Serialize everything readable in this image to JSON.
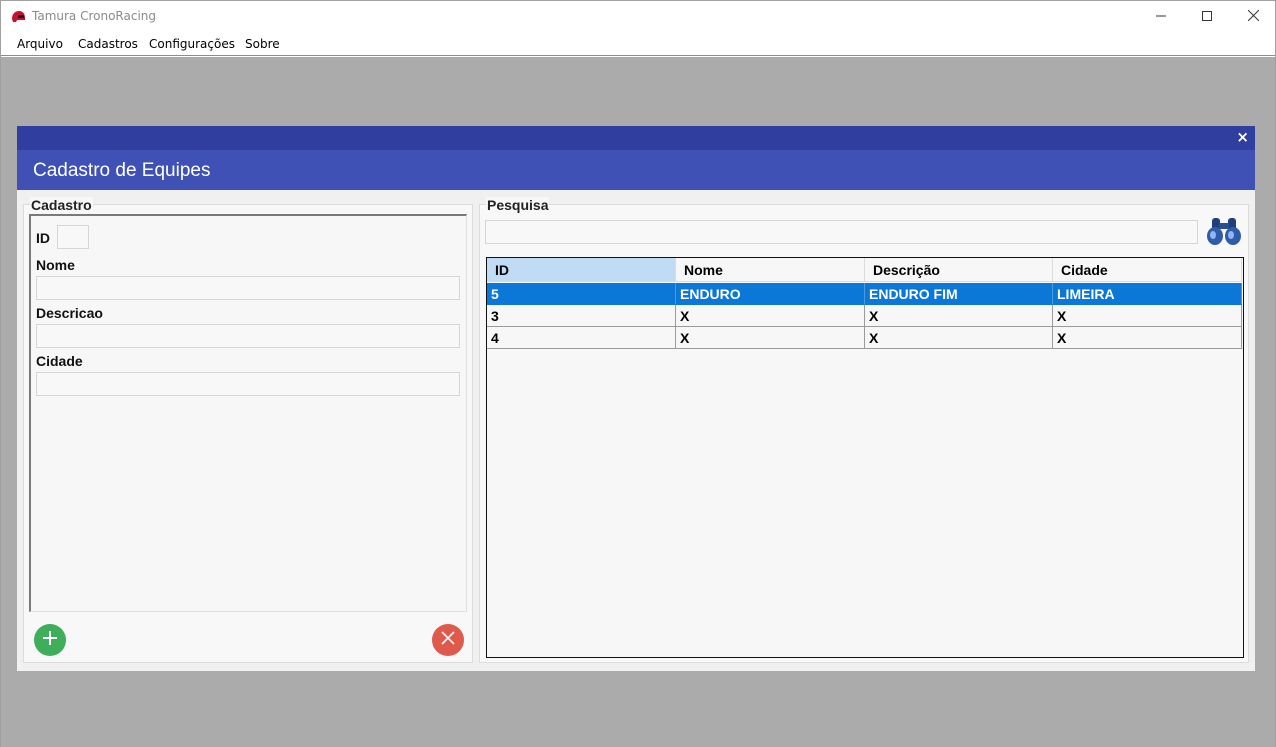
{
  "window": {
    "title": "Tamura CronoRacing",
    "icon": "red-helmet-icon",
    "controls": {
      "minimize": "minimize-icon",
      "maximize": "maximize-icon",
      "close": "close-icon"
    }
  },
  "menu": {
    "items": [
      "Arquivo",
      "Cadastros",
      "Configurações",
      "Sobre"
    ]
  },
  "child_window": {
    "title": "Cadastro de Equipes",
    "close_label": "×"
  },
  "cadastro": {
    "group_label": "Cadastro",
    "id_label": "ID",
    "id_value": "",
    "nome_label": "Nome",
    "nome_value": "",
    "descricao_label": "Descricao",
    "descricao_value": "",
    "cidade_label": "Cidade",
    "cidade_value": "",
    "add_icon": "plus-icon",
    "remove_icon": "x-icon"
  },
  "pesquisa": {
    "group_label": "Pesquisa",
    "search_value": "",
    "search_icon": "binoculars-icon",
    "columns": [
      "ID",
      "Nome",
      "Descrição",
      "Cidade"
    ],
    "rows": [
      {
        "id": "5",
        "nome": "ENDURO",
        "descricao": "ENDURO FIM",
        "cidade": "LIMEIRA",
        "selected": true
      },
      {
        "id": "3",
        "nome": "X",
        "descricao": "X",
        "cidade": "X",
        "selected": false
      },
      {
        "id": "4",
        "nome": "X",
        "descricao": "X",
        "cidade": "X",
        "selected": false
      }
    ]
  },
  "colors": {
    "header_dark": "#303f9f",
    "header": "#3f51b5",
    "selection": "#0b78d7",
    "add_button": "#3fae5a",
    "remove_button": "#df5a4d",
    "mdi_background": "#ababab"
  }
}
